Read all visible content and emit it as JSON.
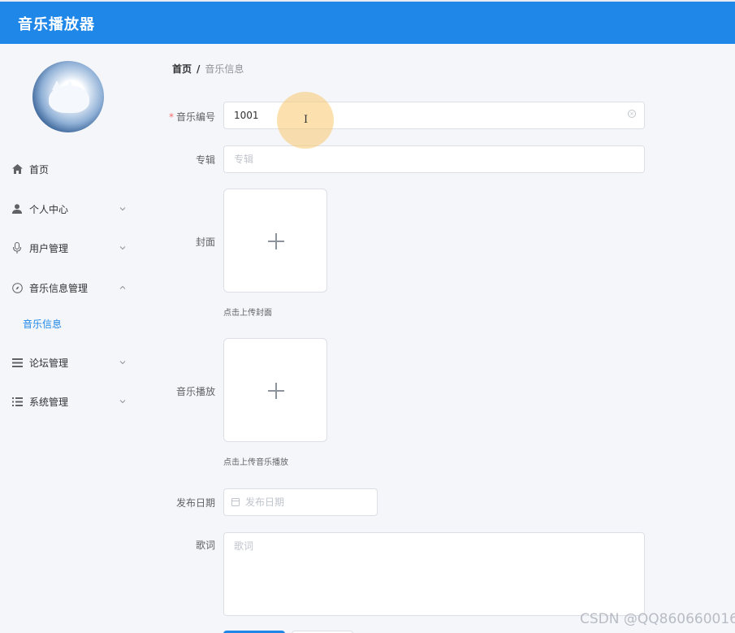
{
  "app": {
    "title": "音乐播放器"
  },
  "sidebar": {
    "items": [
      {
        "label": "首页",
        "icon": "home-icon"
      },
      {
        "label": "个人中心",
        "icon": "user-icon"
      },
      {
        "label": "用户管理",
        "icon": "microphone-icon"
      },
      {
        "label": "音乐信息管理",
        "icon": "compass-icon"
      },
      {
        "label": "音乐信息",
        "icon": ""
      },
      {
        "label": "论坛管理",
        "icon": "list-icon"
      },
      {
        "label": "系统管理",
        "icon": "list-icon"
      }
    ]
  },
  "breadcrumb": {
    "home": "首页",
    "separator": "/",
    "current": "音乐信息"
  },
  "form": {
    "music_id": {
      "label": "音乐编号",
      "value": "1001",
      "required_mark": "*"
    },
    "album": {
      "label": "专辑",
      "placeholder": "专辑"
    },
    "cover": {
      "label": "封面",
      "hint": "点击上传封面"
    },
    "music_file": {
      "label": "音乐播放",
      "hint": "点击上传音乐播放"
    },
    "release_date": {
      "label": "发布日期",
      "placeholder": "发布日期"
    },
    "lyrics": {
      "label": "歌词",
      "placeholder": "歌词"
    }
  },
  "colors": {
    "header": "#1e87e8",
    "accent": "#1e87e8",
    "required": "#f56c6c"
  },
  "watermark": "CSDN @QQ860660016"
}
